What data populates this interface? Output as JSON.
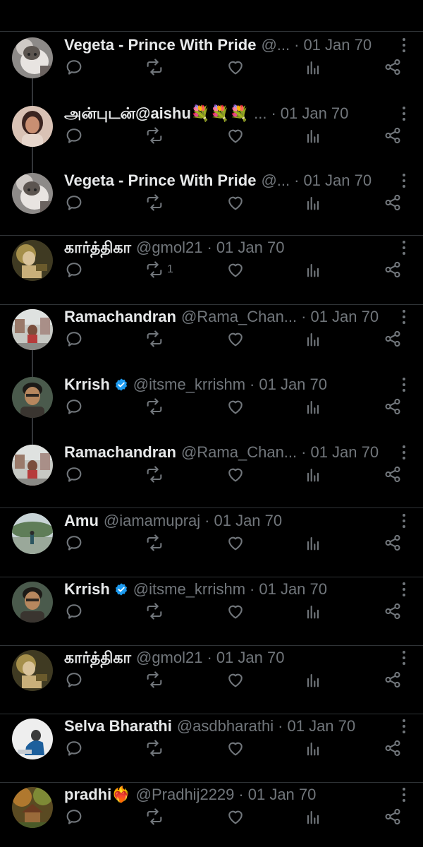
{
  "colors": {
    "background": "#000000",
    "text": "#e7e9ea",
    "muted": "#71767b",
    "divider": "#2f3336",
    "verified": "#1d9bf0"
  },
  "tweets": [
    {
      "name": "Vegeta - Prince With Pride",
      "handle": "@...",
      "dot": "·",
      "date": "01 Jan 70",
      "verified": false,
      "avatar_icon": "cat-photo-avatar",
      "retweets": "",
      "emoji": ""
    },
    {
      "name": "அன்புடன்@aishu💐💐💐",
      "handle": "...",
      "dot": "·",
      "date": "01 Jan 70",
      "verified": false,
      "avatar_icon": "woman-photo-avatar",
      "retweets": "",
      "emoji": ""
    },
    {
      "name": "Vegeta - Prince With Pride",
      "handle": "@...",
      "dot": "·",
      "date": "01 Jan 70",
      "verified": false,
      "avatar_icon": "cat-photo-avatar",
      "retweets": "",
      "emoji": ""
    },
    {
      "name": "கார்த்திகா",
      "handle": "@gmol21",
      "dot": "·",
      "date": "01 Jan 70",
      "verified": false,
      "avatar_icon": "painting-avatar",
      "retweets": "1",
      "emoji": ""
    },
    {
      "name": "Ramachandran",
      "handle": "@Rama_Chan...",
      "dot": "·",
      "date": "01 Jan 70",
      "verified": false,
      "avatar_icon": "street-photo-avatar",
      "retweets": "",
      "emoji": ""
    },
    {
      "name": "Krrish",
      "handle": "@itsme_krrishm",
      "dot": "·",
      "date": "01 Jan 70",
      "verified": true,
      "avatar_icon": "man-portrait-avatar",
      "retweets": "",
      "emoji": ""
    },
    {
      "name": "Ramachandran",
      "handle": "@Rama_Chan...",
      "dot": "·",
      "date": "01 Jan 70",
      "verified": false,
      "avatar_icon": "street-photo-avatar",
      "retweets": "",
      "emoji": ""
    },
    {
      "name": "Amu",
      "handle": "@iamamupraj",
      "dot": "·",
      "date": "01 Jan 70",
      "verified": false,
      "avatar_icon": "landscape-avatar",
      "retweets": "",
      "emoji": ""
    },
    {
      "name": "Krrish",
      "handle": "@itsme_krrishm",
      "dot": "·",
      "date": "01 Jan 70",
      "verified": true,
      "avatar_icon": "man-portrait-avatar",
      "retweets": "",
      "emoji": ""
    },
    {
      "name": "கார்த்திகா",
      "handle": "@gmol21",
      "dot": "·",
      "date": "01 Jan 70",
      "verified": false,
      "avatar_icon": "painting-avatar",
      "retweets": "",
      "emoji": ""
    },
    {
      "name": "Selva Bharathi",
      "handle": "@asdbharathi",
      "dot": "·",
      "date": "01 Jan 70",
      "verified": false,
      "avatar_icon": "artwork-avatar",
      "retweets": "",
      "emoji": ""
    },
    {
      "name": "pradhi",
      "handle": "@Pradhij2229",
      "dot": "·",
      "date": "01 Jan 70",
      "verified": false,
      "avatar_icon": "cottage-avatar",
      "retweets": "",
      "emoji": "❤️‍🔥"
    }
  ]
}
